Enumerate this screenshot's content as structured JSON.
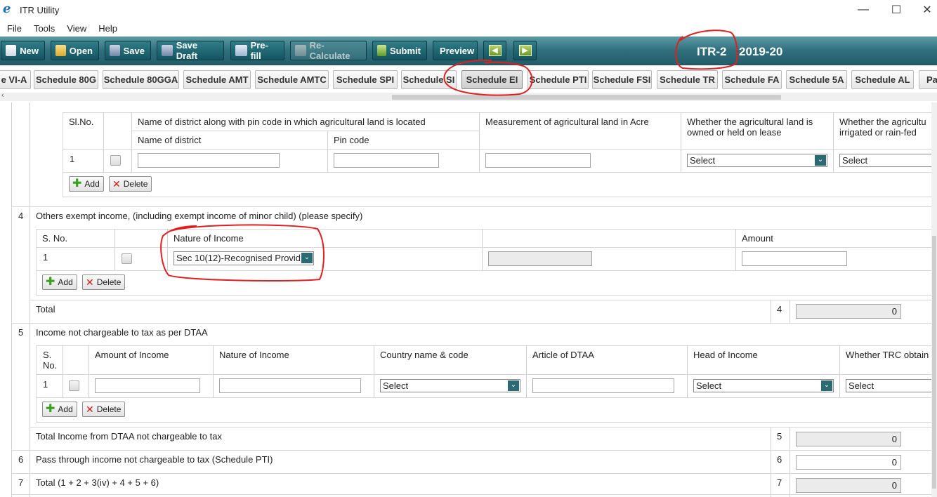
{
  "window": {
    "title": "ITR Utility",
    "minimize": "—",
    "maximize": "☐",
    "close": "✕"
  },
  "menu": [
    "File",
    "Tools",
    "View",
    "Help"
  ],
  "toolbar": {
    "new": "New",
    "open": "Open",
    "save": "Save",
    "save_draft": "Save Draft",
    "prefill": "Pre-fill",
    "recalculate": "Re-Calculate",
    "submit": "Submit",
    "preview": "Preview",
    "form_name": "ITR-2",
    "assessment_year": "2019-20"
  },
  "tabs": [
    "e VI-A",
    "Schedule 80G",
    "Schedule 80GGA",
    "Schedule AMT",
    "Schedule AMTC",
    "Schedule SPI",
    "Schedule SI",
    "Schedule EI",
    "Schedule PTI",
    "Schedule FSI",
    "Schedule TR",
    "Schedule FA",
    "Schedule 5A",
    "Schedule AL",
    "Pa"
  ],
  "active_tab": "Schedule EI",
  "agri_table": {
    "sl_no": "Sl.No.",
    "district_group": "Name of district along with pin code in which agricultural land is located",
    "district": "Name of district",
    "pincode": "Pin code",
    "measurement": "Measurement of agricultural land in Acre",
    "owned": "Whether the agricultural land is owned or held on lease",
    "irrigated": "Whether the agricultu irrigated or rain-fed",
    "row_no": "1",
    "owned_value": "Select",
    "irrigated_value": "Select"
  },
  "buttons": {
    "add": "Add",
    "delete": "Delete"
  },
  "row4": {
    "num": "4",
    "title": "Others exempt income, (including exempt income of minor child) (please specify)",
    "col_sno": "S. No.",
    "col_nature": "Nature of Income",
    "col_amount": "Amount",
    "row_no": "1",
    "nature_value": "Sec 10(12)-Recognised Provid",
    "total_label": "Total",
    "total_num": "4",
    "total_value": "0"
  },
  "row5": {
    "num": "5",
    "title": "Income not chargeable to tax as per DTAA",
    "col_sno": "S.\nNo.",
    "col_sno_1": "S.",
    "col_sno_2": "No.",
    "col_amount": "Amount of Income",
    "col_nature": "Nature of Income",
    "col_country": "Country name & code",
    "col_article": "Article of DTAA",
    "col_head": "Head of Income",
    "col_trc": "Whether TRC obtain",
    "row_no": "1",
    "country_value": "Select",
    "head_value": "Select",
    "trc_value": "Select",
    "total_label": "Total Income from DTAA not chargeable to tax",
    "total_num": "5",
    "total_value": "0"
  },
  "row6": {
    "num": "6",
    "title": "Pass through income not chargeable to tax (Schedule PTI)",
    "box_num": "6",
    "value": "0"
  },
  "row7": {
    "num": "7",
    "title": "Total (1 + 2 + 3(iv) + 4 + 5 + 6)",
    "box_num": "7",
    "value": "0"
  },
  "colors": {
    "toolbar": "#2f6f7c",
    "annotation": "#e02020"
  }
}
